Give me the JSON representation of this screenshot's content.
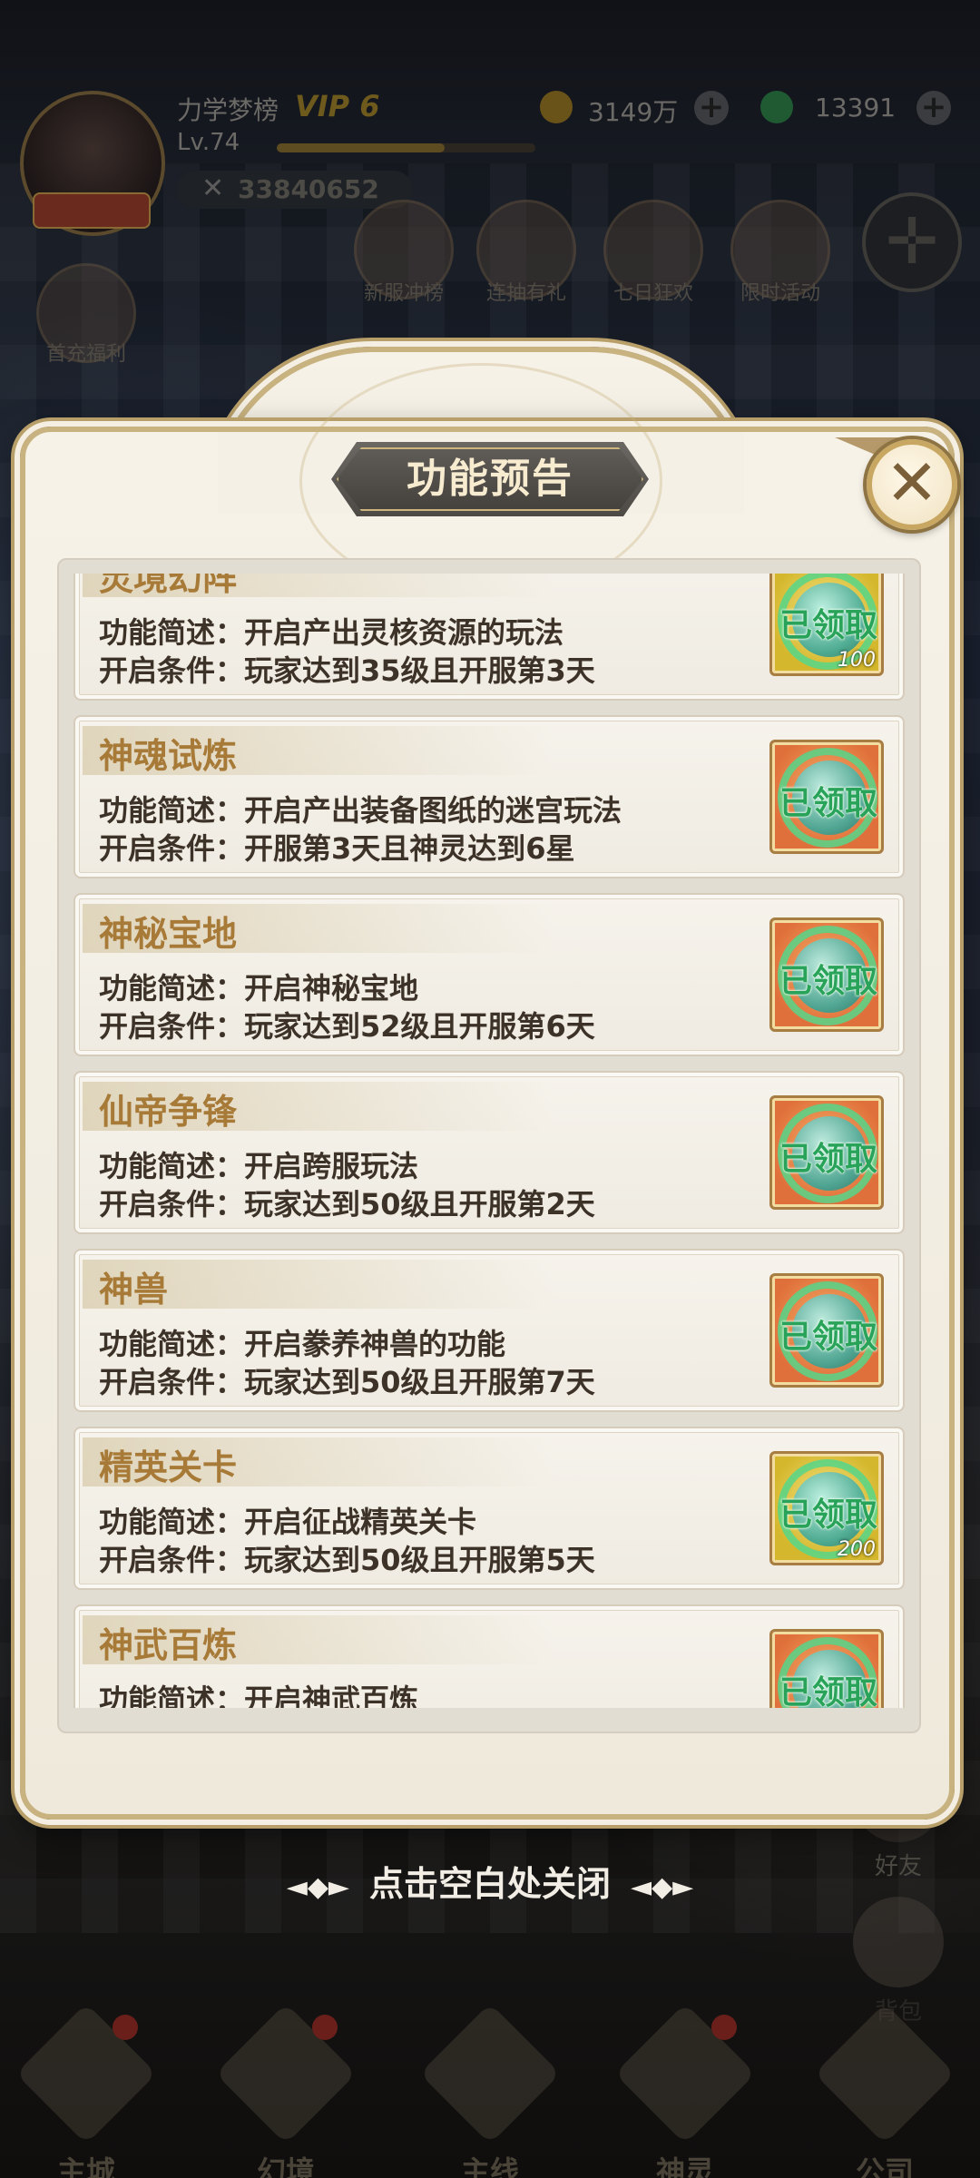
{
  "player": {
    "name": "力学梦榜",
    "vip": "VIP 6",
    "level": "Lv.74",
    "exp_fraction": 0.65,
    "power": "33840652",
    "gold": "3149万",
    "jade": "13391"
  },
  "background": {
    "top_icons": [
      "新服冲榜",
      "连抽有礼",
      "七日狂欢",
      "限时活动"
    ],
    "left_icon": "首充福利",
    "side_items": [
      "好友",
      "背包"
    ]
  },
  "dialog": {
    "title": "功能预告",
    "close_hint": "点击空白处关闭",
    "items": [
      {
        "name": "灵境幻阵",
        "desc": "功能简述：开启产出灵核资源的玩法",
        "cond": "开启条件：玩家达到35级且开服第3天",
        "status": "已领取",
        "reward_bg": "gold",
        "count": "100"
      },
      {
        "name": "神魂试炼",
        "desc": "功能简述：开启产出装备图纸的迷宫玩法",
        "cond": "开启条件：开服第3天且神灵达到6星",
        "status": "已领取",
        "reward_bg": "orange",
        "count": ""
      },
      {
        "name": "神秘宝地",
        "desc": "功能简述：开启神秘宝地",
        "cond": "开启条件：玩家达到52级且开服第6天",
        "status": "已领取",
        "reward_bg": "orange",
        "count": ""
      },
      {
        "name": "仙帝争锋",
        "desc": "功能简述：开启跨服玩法",
        "cond": "开启条件：玩家达到50级且开服第2天",
        "status": "已领取",
        "reward_bg": "orange",
        "count": ""
      },
      {
        "name": "神兽",
        "desc": "功能简述：开启豢养神兽的功能",
        "cond": "开启条件：玩家达到50级且开服第7天",
        "status": "已领取",
        "reward_bg": "orange",
        "count": ""
      },
      {
        "name": "精英关卡",
        "desc": "功能简述：开启征战精英关卡",
        "cond": "开启条件：玩家达到50级且开服第5天",
        "status": "已领取",
        "reward_bg": "gold",
        "count": "200"
      },
      {
        "name": "神武百炼",
        "desc": "功能简述：开启神武百炼",
        "cond": "",
        "status": "已领取",
        "reward_bg": "orange",
        "count": ""
      }
    ]
  },
  "bottom_nav": [
    {
      "label": "主城",
      "badge": true
    },
    {
      "label": "幻境",
      "badge": true
    },
    {
      "label": "主线",
      "badge": false
    },
    {
      "label": "神灵",
      "badge": true
    },
    {
      "label": "公司",
      "badge": false
    }
  ],
  "colors": {
    "title_text": "#f8ecd0",
    "item_name": "#a87a38",
    "item_text": "#3d3227",
    "stamp_green": "#2aa35a",
    "frame_gold": "#c8b27f"
  }
}
